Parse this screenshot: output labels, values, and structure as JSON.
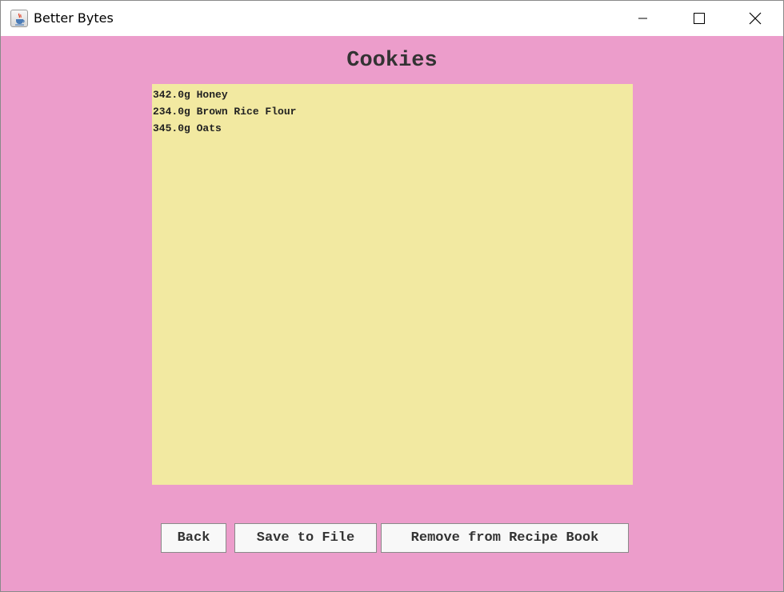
{
  "window": {
    "title": "Better Bytes",
    "icon": "java-coffee-cup-icon",
    "controls": [
      "minimize-icon",
      "maximize-icon",
      "close-icon"
    ]
  },
  "colors": {
    "background": "#ec9dcb",
    "text_area": "#f2e9a1",
    "button": "#f8f8f8"
  },
  "recipe": {
    "title": "Cookies",
    "ingredients": [
      "342.0g Honey",
      "234.0g Brown Rice Flour",
      "345.0g Oats"
    ]
  },
  "buttons": {
    "back": "Back",
    "save": "Save to File",
    "remove": "Remove from Recipe Book"
  }
}
